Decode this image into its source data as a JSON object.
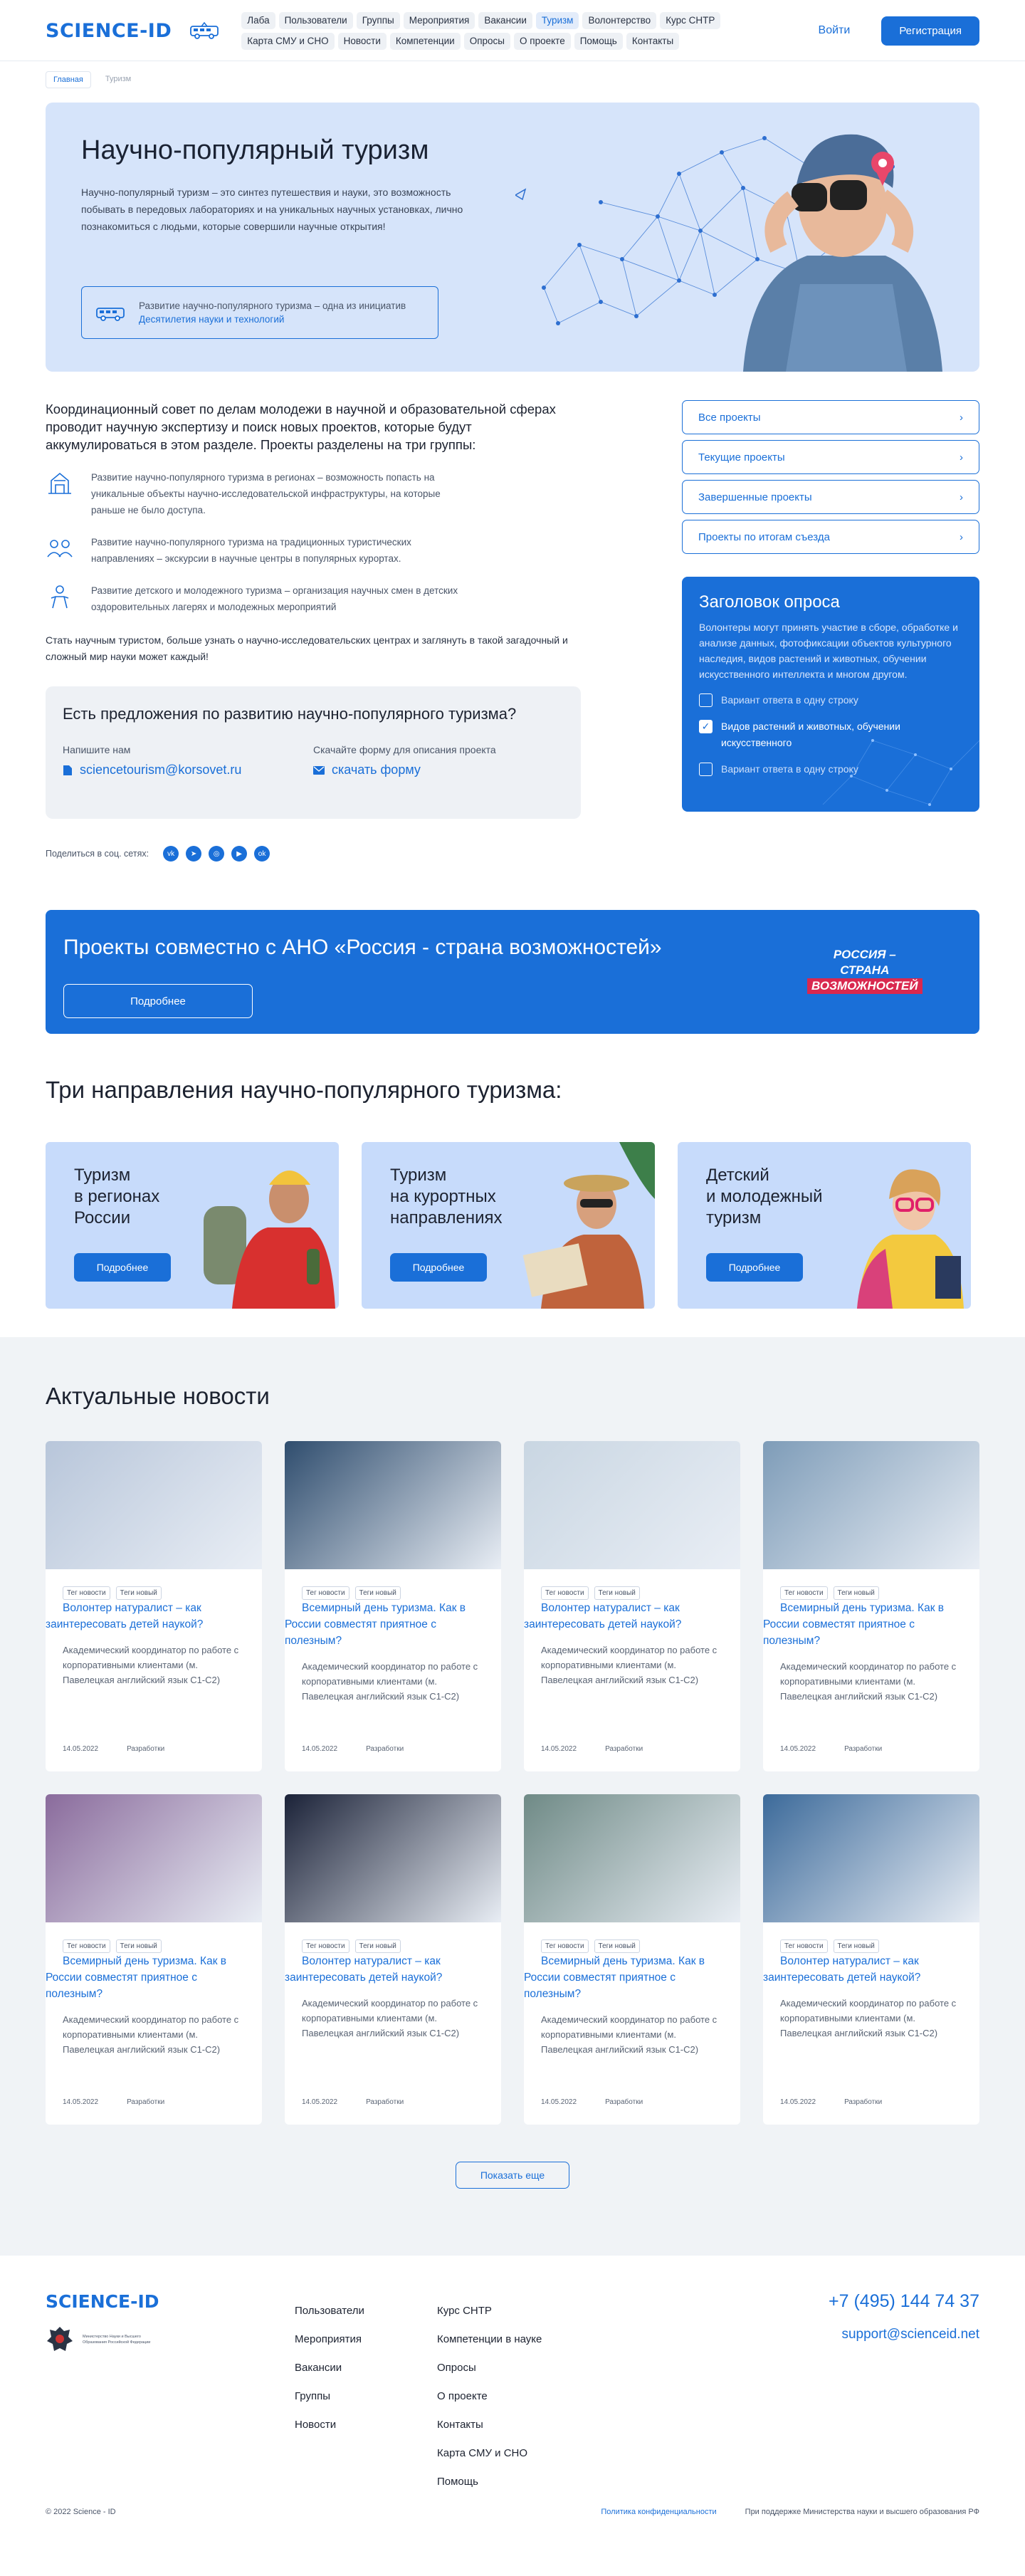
{
  "header": {
    "logo": "SCIENCE-ID",
    "nav": [
      "Лаба",
      "Пользователи",
      "Группы",
      "Мероприятия",
      "Вакансии",
      "Туризм",
      "Волонтерство",
      "Курс СНТР",
      "Карта СМУ и СНО",
      "Новости",
      "Компетенции",
      "Опросы",
      "О проекте",
      "Помощь",
      "Контакты"
    ],
    "nav_active": "Туризм",
    "login": "Войти",
    "register": "Регистрация"
  },
  "breadcrumb": {
    "home": "Главная",
    "current": "Туризм"
  },
  "hero": {
    "title": "Научно-популярный туризм",
    "lead": "Научно-популярный туризм – это синтез путешествия и науки, это возможность побывать в передовых лабораториях и на уникальных научных установках, лично познакомиться с людьми, которые совершили научные открытия!",
    "initiative_text": "Развитие научно-популярного туризма – одна из инициатив",
    "initiative_link": "Десятилетия науки и технологий"
  },
  "about": {
    "intro": "Координационный совет по делам молодежи в научной и образовательной сферах проводит научную экспертизу и поиск новых проектов, которые будут аккумулироваться в этом разделе. Проекты разделены на три группы:",
    "directions": [
      "Развитие научно-популярного туризма в регионах – возможность попасть на уникальные объекты научно-исследовательской инфраструктуры, на которые раньше не было доступа.",
      "Развитие научно-популярного туризма на традиционных туристических направлениях – экскурсии в научные центры в популярных курортах.",
      "Развитие детского и молодежного туризма – организация научных смен в детских оздоровительных лагерях и молодежных мероприятий"
    ],
    "outro": "Стать научным туристом, больше узнать о научно-исследовательских центрах и заглянуть в такой загадочный и сложный мир науки может каждый!"
  },
  "proposal": {
    "title": "Есть предложения по развитию научно-популярного туризма?",
    "write_label": "Напишите нам",
    "email": "sciencetourism@korsovet.ru",
    "form_label": "Скачайте форму для описания проекта",
    "form_link": "скачать форму"
  },
  "share": {
    "label": "Поделиться в соц. сетях:",
    "icons": [
      "vk-icon",
      "telegram-icon",
      "odnoklassniki-icon",
      "youtube-icon",
      "ok-icon"
    ]
  },
  "project_links": [
    "Все проекты",
    "Текущие проекты",
    "Завершенные проекты",
    "Проекты по итогам съезда"
  ],
  "poll": {
    "title": "Заголовок опроса",
    "description": "Волонтеры могут принять участие в сборе, обработке и анализе данных, фотофиксации объектов культурного наследия, видов растений и животных, обучении искусственного интеллекта и многом другом.",
    "options": [
      {
        "label": "Вариант ответа в одну строку",
        "checked": false
      },
      {
        "label": "Видов растений и животных, обучении искусственного",
        "checked": true
      },
      {
        "label": "Вариант ответа в одну строку",
        "checked": false
      }
    ]
  },
  "banner": {
    "title": "Проекты совместно с АНО «Россия - страна возможностей»",
    "button": "Подробнее",
    "logo_lines": [
      "РОССИЯ –",
      "СТРАНА",
      "ВОЗМОЖНОСТЕЙ"
    ]
  },
  "directions": {
    "title": "Три направления научно-популярного туризма:",
    "cards": [
      {
        "title": "Туризм в регионах России",
        "lines": [
          "Туризм",
          "в регионах",
          "России"
        ],
        "button": "Подробнее"
      },
      {
        "title": "Туризм на курортных направлениях",
        "lines": [
          "Туризм",
          "на курортных",
          "направлениях"
        ],
        "button": "Подробнее"
      },
      {
        "title": "Детский и молодежный туризм",
        "lines": [
          "Детский",
          "и молодежный",
          "туризм"
        ],
        "button": "Подробнее"
      }
    ]
  },
  "news": {
    "title": "Актуальные новости",
    "items": [
      {
        "tags": [
          "Тег новости",
          "Теги новый"
        ],
        "title": "Волонтер натуралист – как заинтересовать детей наукой?",
        "desc": "Академический координатор по работе с корпоративными клиентами (м. Павелецкая английский язык С1-С2)",
        "date": "14.05.2022",
        "author": "Разработки",
        "color": "#b8c6da"
      },
      {
        "tags": [
          "Тег новости",
          "Теги новый"
        ],
        "title": "Всемирный день туризма. Как в России совместят приятное с полезным?",
        "desc": "Академический координатор по работе с корпоративными клиентами (м. Павелецкая английский язык С1-С2)",
        "date": "14.05.2022",
        "author": "Разработки",
        "color": "#2f4d6e"
      },
      {
        "tags": [
          "Тег новости",
          "Теги новый"
        ],
        "title": "Волонтер натуралист – как заинтересовать детей наукой?",
        "desc": "Академический координатор по работе с корпоративными клиентами (м. Павелецкая английский язык С1-С2)",
        "date": "14.05.2022",
        "author": "Разработки",
        "color": "#c9d6e2"
      },
      {
        "tags": [
          "Тег новости",
          "Теги новый"
        ],
        "title": "Всемирный день туризма. Как в России совместят приятное с полезным?",
        "desc": "Академический координатор по работе с корпоративными клиентами (м. Павелецкая английский язык С1-С2)",
        "date": "14.05.2022",
        "author": "Разработки",
        "color": "#7e9cb8"
      },
      {
        "tags": [
          "Тег новости",
          "Теги новый"
        ],
        "title": "Всемирный день туризма. Как в России совместят приятное с полезным?",
        "desc": "Академический координатор по работе с корпоративными клиентами (м. Павелецкая английский язык С1-С2)",
        "date": "14.05.2022",
        "author": "Разработки",
        "color": "#8a6b9c"
      },
      {
        "tags": [
          "Тег новости",
          "Теги новый"
        ],
        "title": "Волонтер натуралист – как заинтересовать детей наукой?",
        "desc": "Академический координатор по работе с корпоративными клиентами (м. Павелецкая английский язык С1-С2)",
        "date": "14.05.2022",
        "author": "Разработки",
        "color": "#1b2238"
      },
      {
        "tags": [
          "Тег новости",
          "Теги новый"
        ],
        "title": "Всемирный день туризма. Как в России совместят приятное с полезным?",
        "desc": "Академический координатор по работе с корпоративными клиентами (м. Павелецкая английский язык С1-С2)",
        "date": "14.05.2022",
        "author": "Разработки",
        "color": "#6f8a86"
      },
      {
        "tags": [
          "Тег новости",
          "Теги новый"
        ],
        "title": "Волонтер натуралист – как заинтересовать детей наукой?",
        "desc": "Академический координатор по работе с корпоративными клиентами (м. Павелецкая английский язык С1-С2)",
        "date": "14.05.2022",
        "author": "Разработки",
        "color": "#3c6a9a"
      }
    ],
    "more": "Показать еще"
  },
  "footer": {
    "logo": "SCIENCE-ID",
    "ministry": "Министерство Науки и Высшего Образования Российской Федерации",
    "col1": [
      "Пользователи",
      "Мероприятия",
      "Вакансии",
      "Группы",
      "Новости"
    ],
    "col2": [
      "Курс СНТР",
      "Компетенции в науке",
      "Опросы",
      "О проекте",
      "Контакты",
      "Карта СМУ и СНО",
      "Помощь"
    ],
    "phone": "+7 (495) 144 74 37",
    "email": "support@scienceid.net",
    "copyright": "© 2022 Science - ID",
    "privacy": "Политика конфиденциальности",
    "support": "При поддержке Министерства науки и высшего образования РФ"
  },
  "colors": {
    "accent": "#1a6fd8",
    "hero_bg": "#d6e4fa",
    "card_bg": "#c7dbfb",
    "news_bg": "#f0f3f6"
  }
}
